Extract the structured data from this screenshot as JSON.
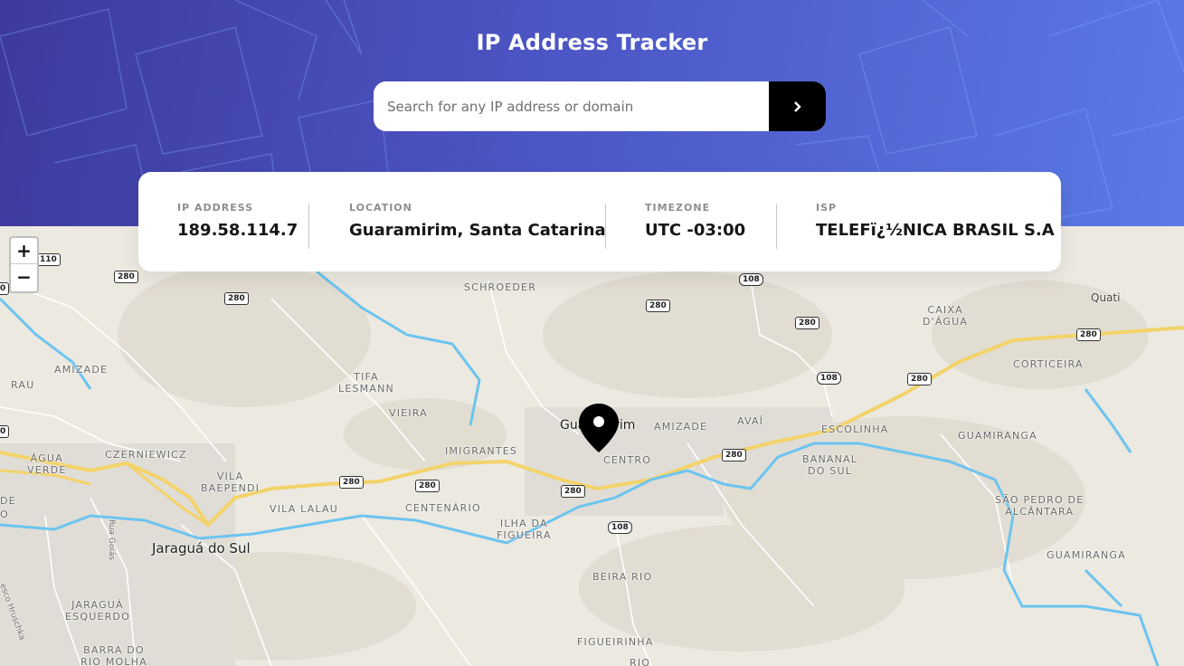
{
  "app": {
    "title": "IP Address Tracker"
  },
  "search": {
    "placeholder": "Search for any IP address or domain",
    "value": "",
    "submit_icon": "chevron-right-icon"
  },
  "info": {
    "ip_label": "IP ADDRESS",
    "ip_value": "189.58.114.7",
    "location_label": "LOCATION",
    "location_value": "Guaramirim, Santa Catarina",
    "timezone_label": "TIMEZONE",
    "timezone_value": "UTC -03:00",
    "isp_label": "ISP",
    "isp_value": "TELEFï¿½NICA BRASIL S.A"
  },
  "map": {
    "zoom_in": "+",
    "zoom_out": "−",
    "marker_icon": "location-pin-icon",
    "labels": {
      "schroeder": "SCHROEDER",
      "caixa_dagua": "CAIXA\nD'ÁGUA",
      "quati": "Quati",
      "amizade_w": "AMIZADE",
      "tifa_lesmann": "TIFA\nLESMANN",
      "corticeira": "CORTICEIRA",
      "rau": "RAU",
      "vieira": "VIEIRA",
      "guaramirim": "Guaramirim",
      "amizade_e": "AMIZADE",
      "avai": "AVAÍ",
      "escolinha": "ESCOLINHA",
      "guaramirim_locality": "GUAMIRANGA",
      "agua_verde": "ÁGUA\nVERDE",
      "czerniewicz": "CZERNIEWICZ",
      "imigrantes": "IMIGRANTES",
      "centro": "CENTRO",
      "bananal_do_sul": "BANANAL\nDO SUL",
      "vila_baependi": "VILA\nBAEPENDI",
      "vila_lalau": "VILA LALAU",
      "centenario": "CENTENÁRIO",
      "ilha_da_figueira": "ILHA DA\nFIGUEIRA",
      "sao_pedro": "SÃO PEDRO DE\nALCÂNTARA",
      "jaragua_do_sul": "Jaraguá do Sul",
      "guamiranga_s": "GUAMIRANGA",
      "rua_goias": "Rua Goiás",
      "beira_rio": "BEIRA RIO",
      "jaragua_esquerdo": "JARAGUÁ\nESQUERDO",
      "barra_do_rio_molha": "BARRA DO\nRIO MOLHA",
      "figueirinha": "FIGUEIRINHA",
      "hruschka": "esco Hruschka",
      "de": "DE",
      "o": "O",
      "rio": "RIO"
    },
    "shields": {
      "s110": "110",
      "s280a": "280",
      "s280b": "280",
      "s108a": "108",
      "s280c": "280",
      "s280d": "280",
      "s280e": "280",
      "s108b": "108",
      "s280f": "280",
      "s280g": "280",
      "s280h": "280",
      "s280i": "280",
      "s280j": "280",
      "s108c": "108",
      "s0a": "0",
      "s0b": "0"
    }
  },
  "colors": {
    "header_start": "#3d3a9c",
    "header_end": "#5a7ae6",
    "river": "#6cc4ef",
    "highway": "#f3d36a"
  }
}
